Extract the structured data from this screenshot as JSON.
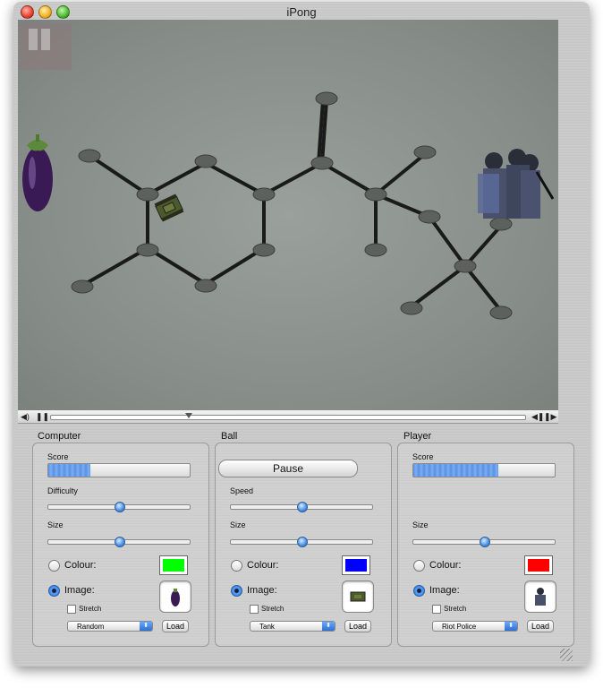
{
  "window": {
    "title": "iPong"
  },
  "controlbar": {
    "volume_icon": "speaker-icon",
    "play_icon": "pause-icon",
    "step_icons": "step-icons"
  },
  "computer": {
    "title": "Computer",
    "score_label": "Score",
    "score_fraction": 0.3,
    "difficulty_label": "Difficulty",
    "difficulty_fraction": 0.5,
    "size_label": "Size",
    "size_fraction": 0.5,
    "colour_label": "Colour:",
    "colour_value": "#00ff00",
    "image_label": "Image:",
    "stretch_label": "Stretch",
    "popup_value": "Random",
    "load_label": "Load",
    "selected": "image"
  },
  "ball": {
    "title": "Ball",
    "pause_label": "Pause",
    "speed_label": "Speed",
    "speed_fraction": 0.5,
    "size_label": "Size",
    "size_fraction": 0.5,
    "colour_label": "Colour:",
    "colour_value": "#0000ff",
    "image_label": "Image:",
    "stretch_label": "Stretch",
    "popup_value": "Tank",
    "load_label": "Load",
    "selected": "image"
  },
  "player": {
    "title": "Player",
    "score_label": "Score",
    "score_fraction": 0.6,
    "size_label": "Size",
    "size_fraction": 0.5,
    "colour_label": "Colour:",
    "colour_value": "#ff0000",
    "image_label": "Image:",
    "stretch_label": "Stretch",
    "popup_value": "Riot Police",
    "load_label": "Load",
    "selected": "image"
  }
}
